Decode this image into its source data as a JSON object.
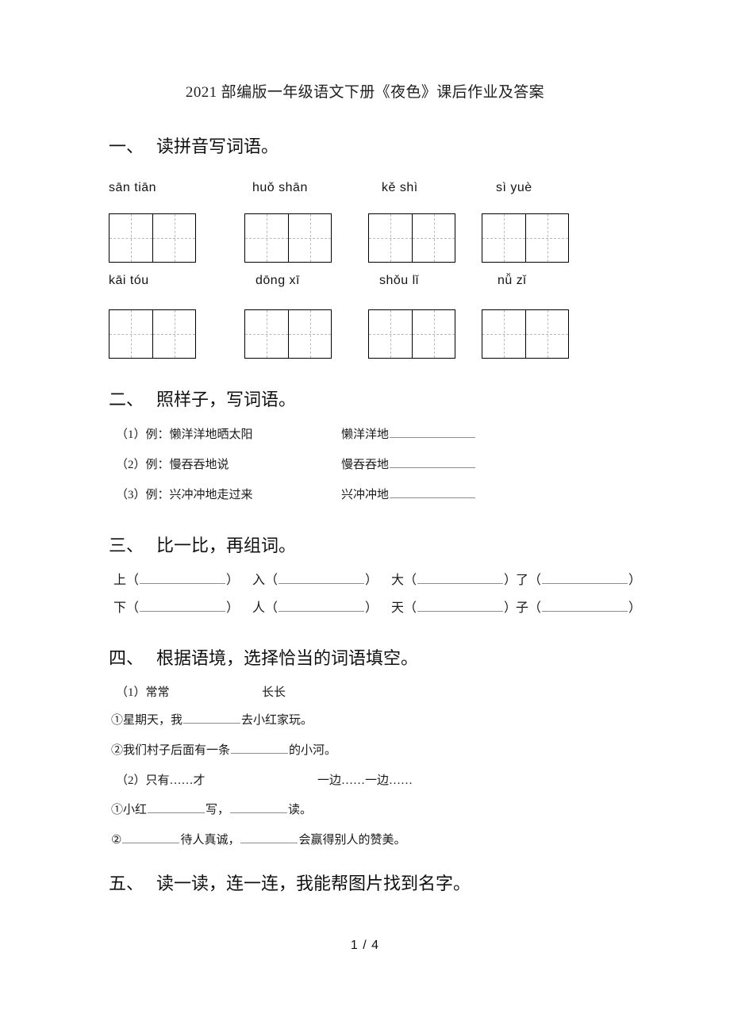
{
  "document": {
    "title": "2021 部编版一年级语文下册《夜色》课后作业及答案",
    "page_indicator": "1 / 4"
  },
  "sections": [
    {
      "number": "一、",
      "heading": "读拼音写词语。",
      "pinyin_rows": [
        [
          "sān  tiān",
          "huǒ  shān",
          "kě  shì",
          "sì  yuè"
        ],
        [
          "kāi  tóu",
          "dōng  xī",
          "shǒu  lǐ",
          "nǚ  zǐ"
        ]
      ],
      "grid_cells_per_box": 2,
      "grid_boxes_per_row": 4
    },
    {
      "number": "二、",
      "heading": "照样子，写词语。",
      "items": [
        {
          "left": "（1）例：懒洋洋地晒太阳",
          "right_prefix": "懒洋洋地"
        },
        {
          "left": "（2）例：慢吞吞地说",
          "right_prefix": "慢吞吞地"
        },
        {
          "left": "（3）例：兴冲冲地走过来",
          "right_prefix": "兴冲冲地"
        }
      ]
    },
    {
      "number": "三、",
      "heading": "比一比，再组词。",
      "pairs": [
        {
          "top": "上",
          "bottom": "下"
        },
        {
          "top": "入",
          "bottom": "人"
        },
        {
          "top": "大",
          "bottom": "天"
        },
        {
          "top": "了",
          "bottom": "子"
        }
      ]
    },
    {
      "number": "四、",
      "heading": "根据语境，选择恰当的词语填空。",
      "groups": [
        {
          "label": "（1）",
          "option_a": "常常",
          "option_b": "长长",
          "questions": [
            {
              "marker": "①",
              "before": "星期天，我",
              "after": "去小红家玩。"
            },
            {
              "marker": "②",
              "before": "我们村子后面有一条",
              "after": "的小河。"
            }
          ]
        },
        {
          "label": "（2）",
          "option_a": "只有……才",
          "option_b": "一边……一边……",
          "questions": [
            {
              "marker": "①",
              "before": "小红",
              "middle": "写，",
              "after": "读。"
            },
            {
              "marker": "②",
              "before": "",
              "middle": "待人真诚，",
              "after": "会赢得别人的赞美。"
            }
          ]
        }
      ]
    },
    {
      "number": "五、",
      "heading": "读一读，连一连，我能帮图片找到名字。"
    }
  ]
}
